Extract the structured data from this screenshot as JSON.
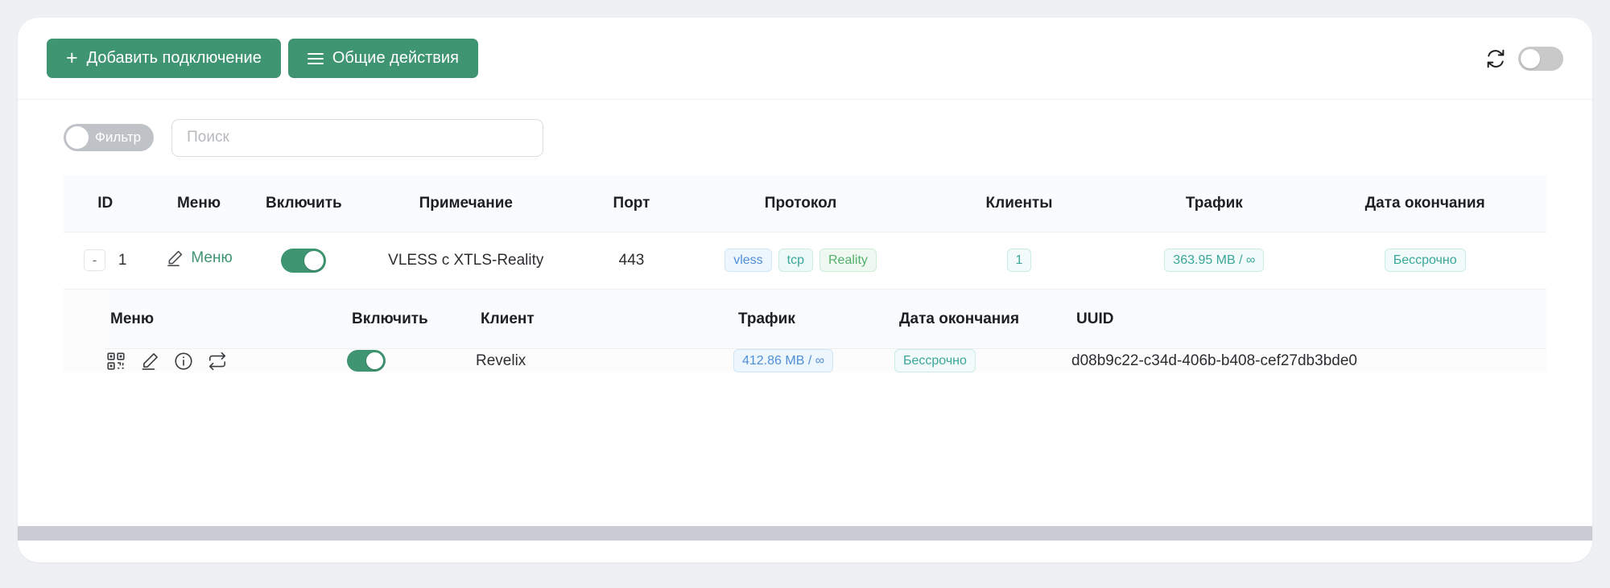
{
  "toolbar": {
    "add_connection_label": "Добавить подключение",
    "general_actions_label": "Общие действия",
    "plus_icon": "plus-icon",
    "burger_icon": "hamburger-icon",
    "refresh_icon": "refresh-icon",
    "autorefresh_toggle_state": "off"
  },
  "filterbar": {
    "filter_label": "Фильтр",
    "filter_toggle_state": "off",
    "search_placeholder": "Поиск",
    "search_value": ""
  },
  "table": {
    "headers": {
      "id": "ID",
      "menu": "Меню",
      "enable": "Включить",
      "note": "Примечание",
      "port": "Порт",
      "protocol": "Протокол",
      "clients": "Клиенты",
      "traffic": "Трафик",
      "expiry": "Дата окончания"
    },
    "rows": [
      {
        "expand_label": "-",
        "id": "1",
        "menu_label": "Меню",
        "enabled": "on",
        "note": "VLESS с XTLS-Reality",
        "port": "443",
        "protocol_badges": [
          {
            "label": "vless",
            "color": "#4f8fd8"
          },
          {
            "label": "tcp",
            "color": "#3aa69b"
          },
          {
            "label": "Reality",
            "color": "#53b06a"
          }
        ],
        "clients": "1",
        "traffic": "363.95 MB / ∞",
        "expiry": "Бессрочно"
      }
    ]
  },
  "subtable": {
    "headers": {
      "menu": "Меню",
      "enable": "Включить",
      "client": "Клиент",
      "traffic": "Трафик",
      "expiry": "Дата окончания",
      "uuid": "UUID"
    },
    "icons": {
      "qr": "qr-code-icon",
      "edit": "pencil-icon",
      "info": "info-circle-icon",
      "reset": "reset-loop-icon"
    },
    "rows": [
      {
        "enabled": "on",
        "client": "Revelix",
        "traffic": "412.86 MB / ∞",
        "expiry": "Бессрочно",
        "uuid": "d08b9c22-c34d-406b-b408-cef27db3bde0"
      }
    ]
  },
  "colors": {
    "brand_green": "#3f9471",
    "page_background": "#eef0f3",
    "card_background": "#ffffff",
    "scrollbar": "#c9ccd2"
  }
}
